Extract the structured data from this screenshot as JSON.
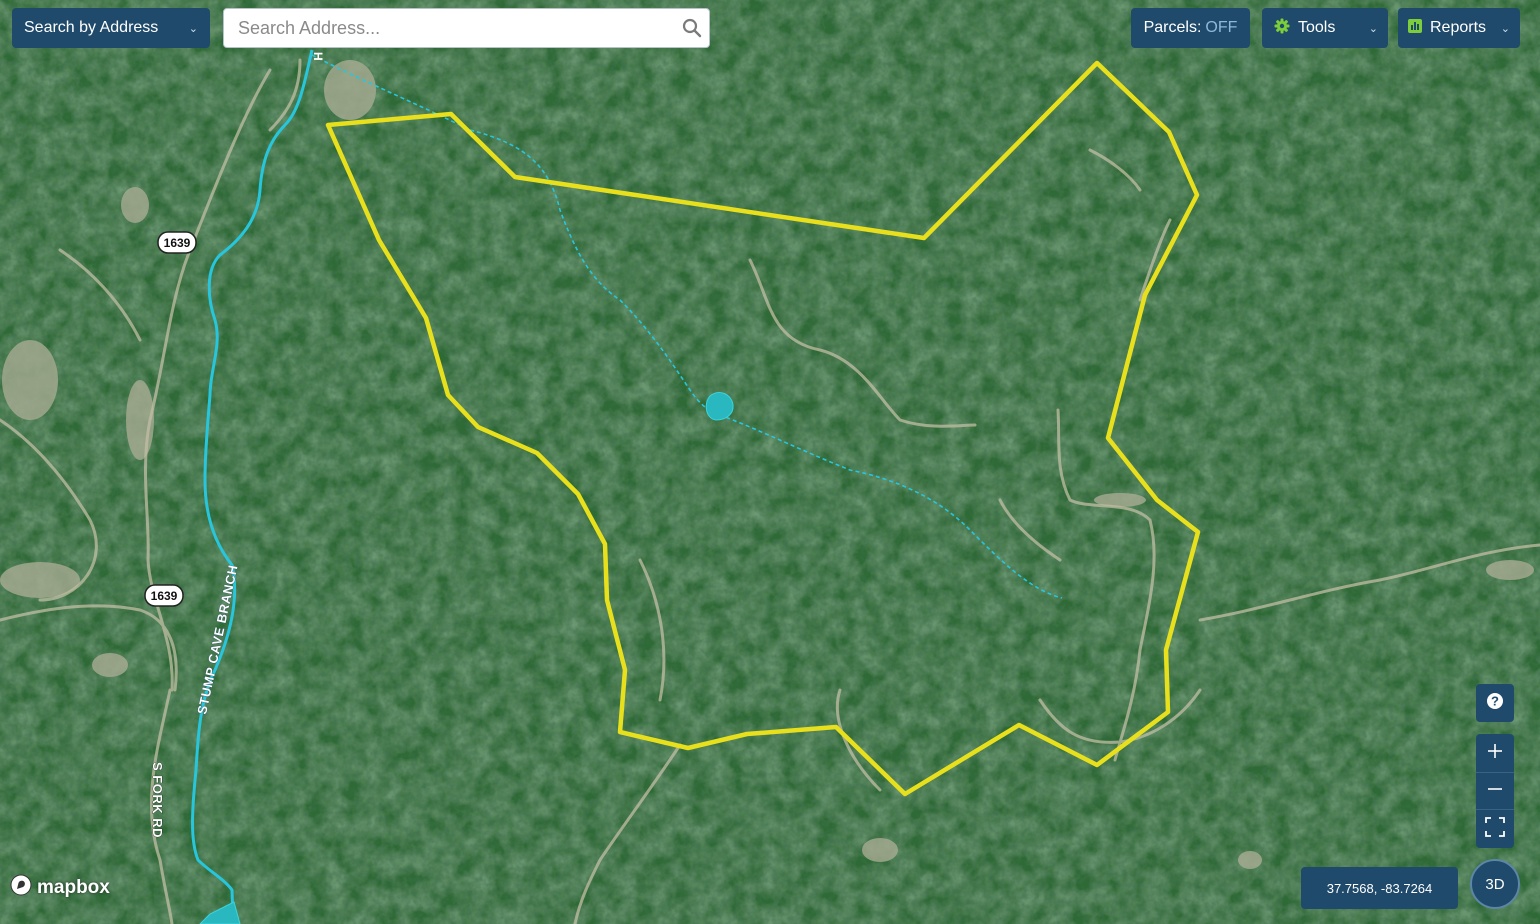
{
  "toolbar": {
    "search_mode_label": "Search by Address",
    "search_placeholder": "Search Address...",
    "parcels_label": "Parcels:",
    "parcels_state": "OFF",
    "tools_label": "Tools",
    "reports_label": "Reports"
  },
  "map": {
    "road_shields": [
      "1639",
      "1639"
    ],
    "stream_label": "STUMP CAVE BRANCH",
    "road_label": "S FORK RD",
    "top_label_fragment": "H",
    "attribution": "mapbox"
  },
  "controls": {
    "help_icon": "question-icon",
    "zoom_in_icon": "plus-icon",
    "zoom_out_icon": "minus-icon",
    "fullscreen_icon": "fullscreen-icon",
    "coordinates": "37.7568, -83.7264",
    "view_3d_label": "3D"
  },
  "colors": {
    "control_bg": "#1f4a6b",
    "parcel_outline": "#e8e01c",
    "stream": "#27c6dd",
    "forest": "#2b5a30",
    "parcels_off": "#8fb8d8",
    "tools_icon": "#7ccf3a",
    "reports_icon": "#7ccf3a"
  }
}
